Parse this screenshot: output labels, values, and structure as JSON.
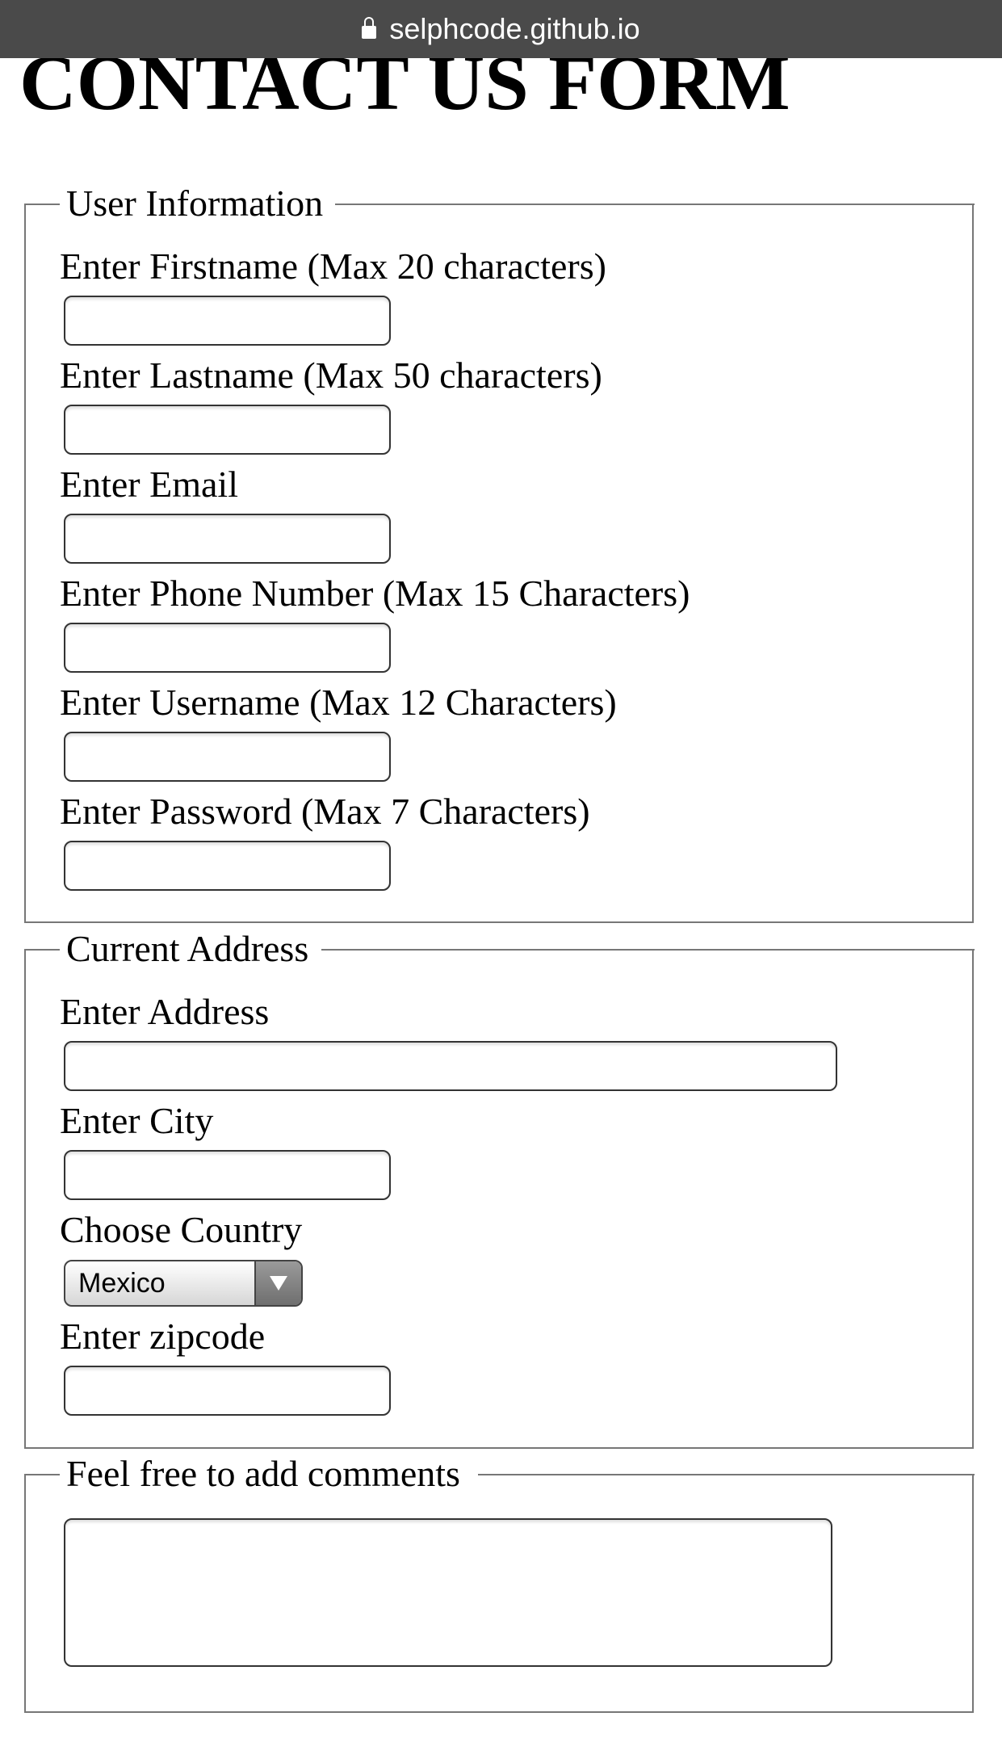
{
  "browser": {
    "url": "selphcode.github.io",
    "lock_icon": "lock-icon"
  },
  "page": {
    "title": "CONTACT US FORM"
  },
  "user_information": {
    "legend": "User Information",
    "firstname_label": "Enter Firstname (Max 20 characters)",
    "firstname_value": "",
    "lastname_label": "Enter Lastname (Max 50 characters)",
    "lastname_value": "",
    "email_label": "Enter Email",
    "email_value": "",
    "phone_label": "Enter Phone Number (Max 15 Characters)",
    "phone_value": "",
    "username_label": "Enter Username (Max 12 Characters)",
    "username_value": "",
    "password_label": "Enter Password (Max 7 Characters)",
    "password_value": ""
  },
  "current_address": {
    "legend": "Current Address",
    "address_label": "Enter Address",
    "address_value": "",
    "city_label": "Enter City",
    "city_value": "",
    "country_label": "Choose Country",
    "country_selected": "Mexico",
    "zipcode_label": "Enter zipcode",
    "zipcode_value": ""
  },
  "comments": {
    "legend": "Feel free to add comments",
    "value": ""
  }
}
